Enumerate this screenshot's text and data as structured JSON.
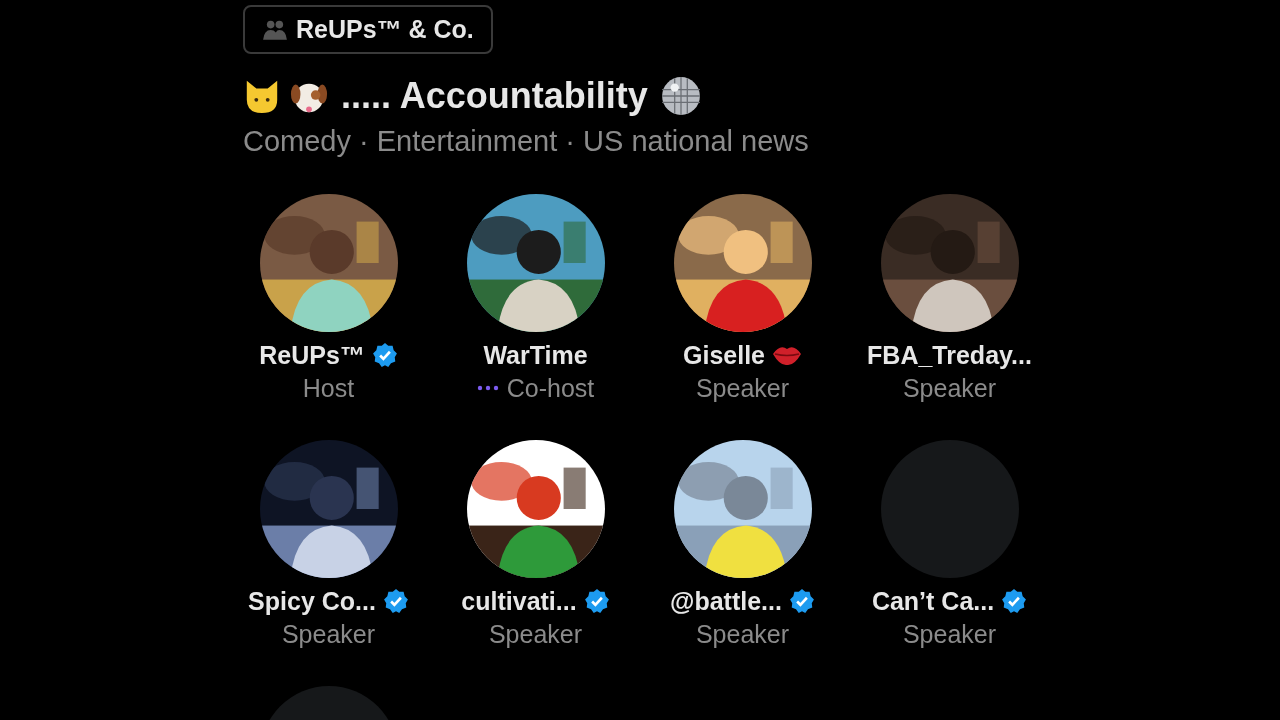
{
  "community": {
    "name": "ReUPs™ & Co."
  },
  "space": {
    "title": "..... Accountability",
    "topics": "Comedy · Entertainment · US national news"
  },
  "participants": [
    {
      "kind": "picture",
      "name": "ReUPs™",
      "verified": true,
      "lips_badge": false,
      "role": "Host",
      "speaking": false
    },
    {
      "kind": "picture",
      "name": "WarTime",
      "verified": false,
      "lips_badge": false,
      "role": "Co-host",
      "speaking": true
    },
    {
      "kind": "picture",
      "name": "Giselle",
      "verified": false,
      "lips_badge": true,
      "role": "Speaker",
      "speaking": false
    },
    {
      "kind": "picture",
      "name": "FBA_Treday...",
      "verified": false,
      "lips_badge": false,
      "role": "Speaker",
      "speaking": false
    },
    {
      "kind": "picture",
      "name": "Spicy Co...",
      "verified": true,
      "lips_badge": false,
      "role": "Speaker",
      "speaking": false
    },
    {
      "kind": "picture",
      "name": "cultivati...",
      "verified": true,
      "lips_badge": false,
      "role": "Speaker",
      "speaking": false
    },
    {
      "kind": "picture",
      "name": "@battle...",
      "verified": true,
      "lips_badge": false,
      "role": "Speaker",
      "speaking": false
    },
    {
      "kind": "placeholder",
      "name": "Can’t Ca...",
      "verified": true,
      "lips_badge": false,
      "role": "Speaker",
      "speaking": false
    },
    {
      "kind": "placeholder"
    }
  ]
}
